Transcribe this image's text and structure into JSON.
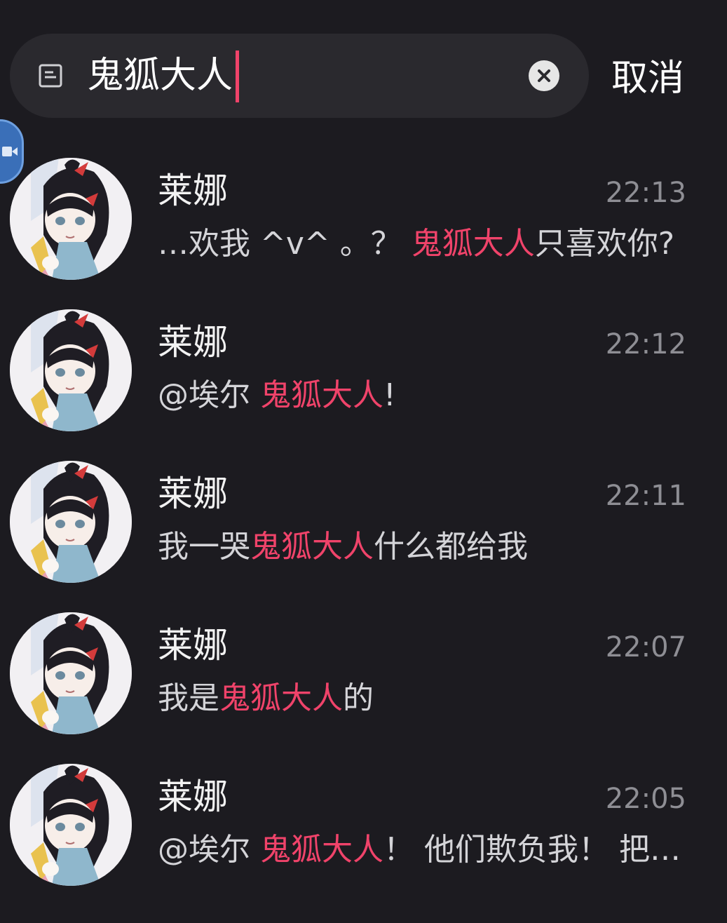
{
  "search": {
    "query": "鬼狐大人",
    "cancel_label": "取消"
  },
  "colors": {
    "background": "#1c1b20",
    "search_bg": "#2a292e",
    "highlight": "#f0436a",
    "time": "#8e8e94"
  },
  "results": [
    {
      "sender": "莱娜",
      "time": "22:13",
      "pre": " …欢我 ^v^ 。？ ",
      "match": "鬼狐大人",
      "post": "只喜欢你?"
    },
    {
      "sender": "莱娜",
      "time": "22:12",
      "pre": "@埃尔 ",
      "match": "鬼狐大人",
      "post": "!"
    },
    {
      "sender": "莱娜",
      "time": "22:11",
      "pre": "我一哭",
      "match": "鬼狐大人",
      "post": "什么都给我"
    },
    {
      "sender": "莱娜",
      "time": "22:07",
      "pre": "我是",
      "match": "鬼狐大人",
      "post": "的"
    },
    {
      "sender": "莱娜",
      "time": "22:05",
      "pre": "@埃尔 ",
      "match": "鬼狐大人",
      "post": "！ 他们欺负我！ 把…"
    }
  ]
}
